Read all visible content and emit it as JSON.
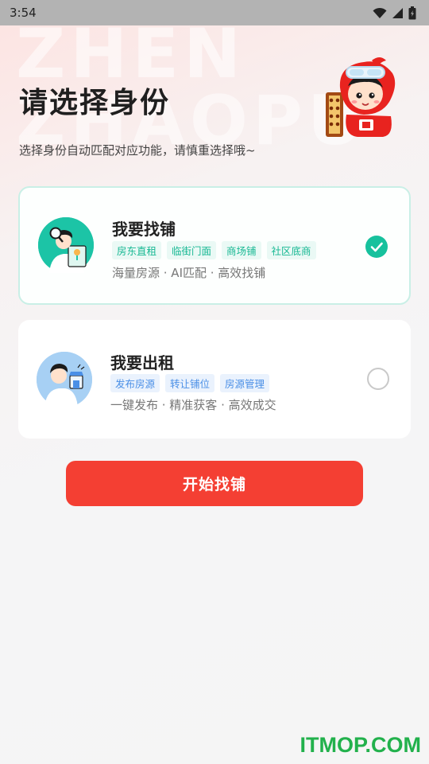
{
  "status_bar": {
    "time": "3:54",
    "icons": [
      "wifi-icon",
      "signal-icon",
      "battery-icon"
    ]
  },
  "watermark": {
    "line1": "ZHEN",
    "line2": "ZHAOPU"
  },
  "header": {
    "title": "请选择身份",
    "subtitle": "选择身份自动匹配对应功能，请慎重选择哦~",
    "mascot_icon": "mascot-icon"
  },
  "cards": [
    {
      "title": "我要找铺",
      "tags": [
        "房东直租",
        "临街门面",
        "商场铺",
        "社区底商"
      ],
      "desc": "海量房源 · AI匹配 · 高效找铺",
      "selected": true
    },
    {
      "title": "我要出租",
      "tags": [
        "发布房源",
        "转让铺位",
        "房源管理"
      ],
      "desc": "一键发布 · 精准获客 · 高效成交",
      "selected": false
    }
  ],
  "start_button": {
    "label": "开始找铺"
  },
  "site_mark": "ITMOP.COM",
  "colors": {
    "accent_red": "#f43f33",
    "accent_green": "#17c19d",
    "tag_green": "#17b893",
    "tag_blue": "#4a8fe6"
  }
}
